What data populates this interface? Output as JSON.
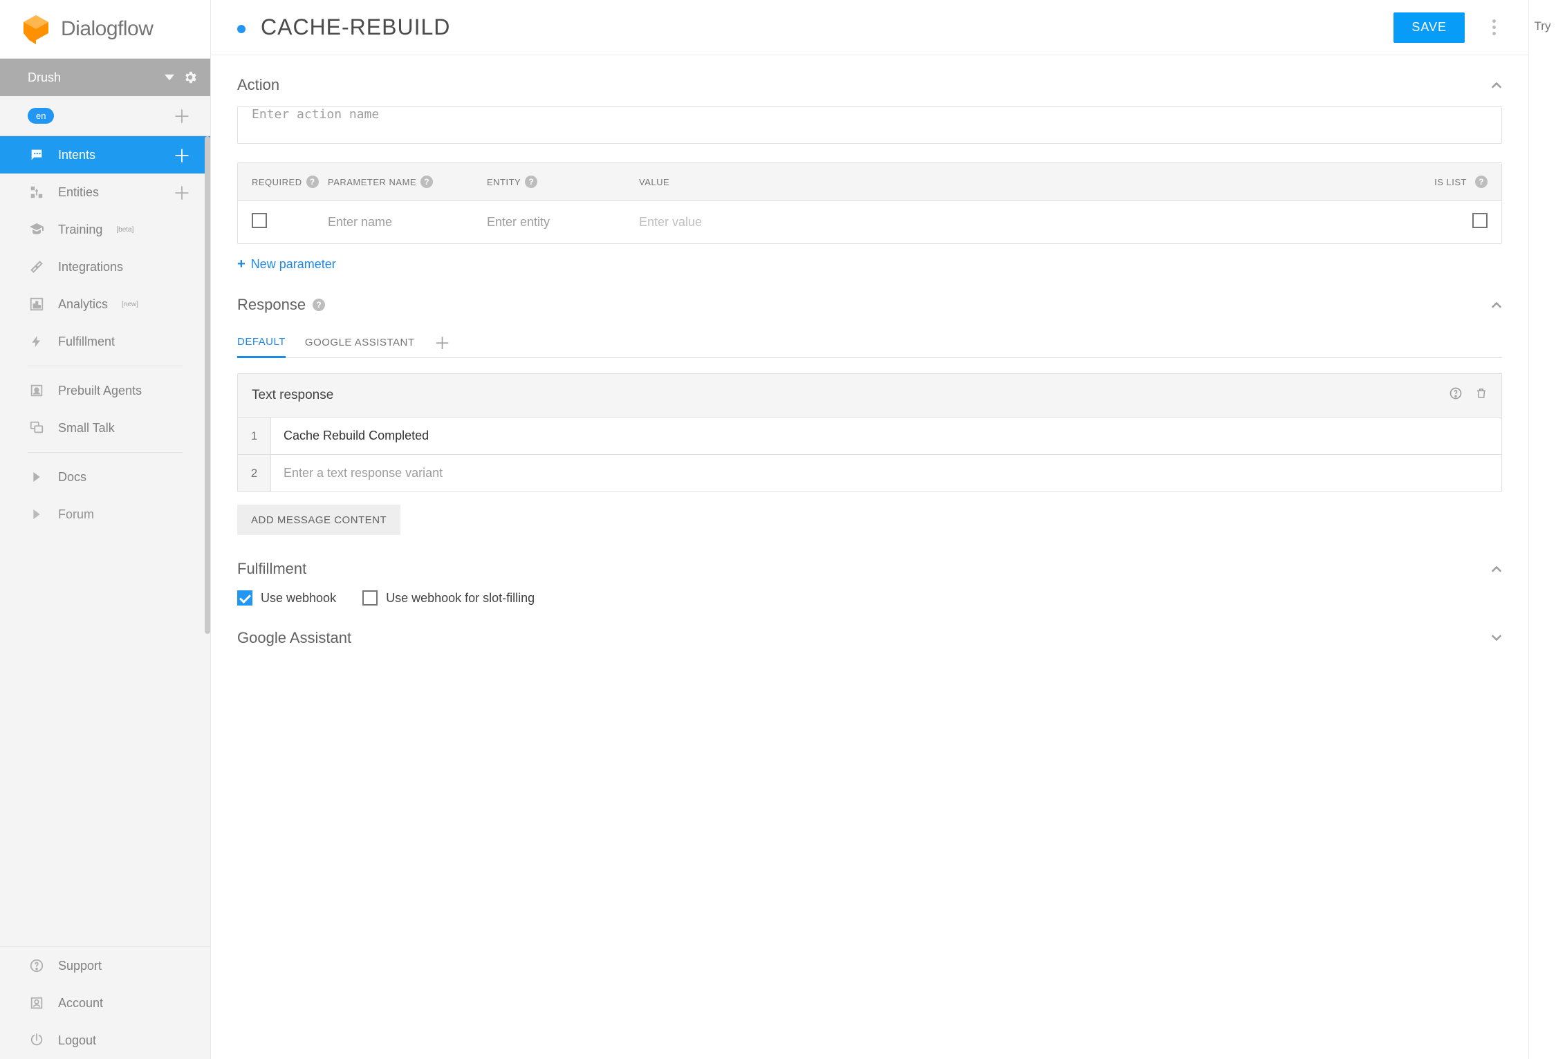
{
  "brand": "Dialogflow",
  "agent": {
    "name": "Drush",
    "language": "en"
  },
  "nav": {
    "intents": "Intents",
    "entities": "Entities",
    "training": "Training",
    "training_badge": "[beta]",
    "integrations": "Integrations",
    "analytics": "Analytics",
    "analytics_badge": "[new]",
    "fulfillment": "Fulfillment",
    "prebuilt": "Prebuilt Agents",
    "smalltalk": "Small Talk",
    "docs": "Docs",
    "forum": "Forum",
    "support": "Support",
    "account": "Account",
    "logout": "Logout"
  },
  "header": {
    "title": "CACHE-REBUILD",
    "save": "SAVE"
  },
  "action": {
    "title": "Action",
    "placeholder": "Enter action name",
    "columns": {
      "required": "REQUIRED",
      "param": "PARAMETER NAME",
      "entity": "ENTITY",
      "value": "VALUE",
      "islist": "IS LIST"
    },
    "row_placeholders": {
      "name": "Enter name",
      "entity": "Enter entity",
      "value": "Enter value"
    },
    "new_param": "New parameter"
  },
  "response": {
    "title": "Response",
    "tabs": {
      "default": "DEFAULT",
      "ga": "GOOGLE ASSISTANT"
    },
    "text_resp_title": "Text response",
    "rows": [
      {
        "n": "1",
        "value": "Cache Rebuild Completed"
      },
      {
        "n": "2",
        "placeholder": "Enter a text response variant"
      }
    ],
    "add_msg": "ADD MESSAGE CONTENT"
  },
  "fulfillment": {
    "title": "Fulfillment",
    "use_webhook": "Use webhook",
    "use_webhook_slot": "Use webhook for slot-filling",
    "webhook_checked": true,
    "slot_checked": false
  },
  "ga_section": {
    "title": "Google Assistant"
  },
  "right_strip": "Try"
}
